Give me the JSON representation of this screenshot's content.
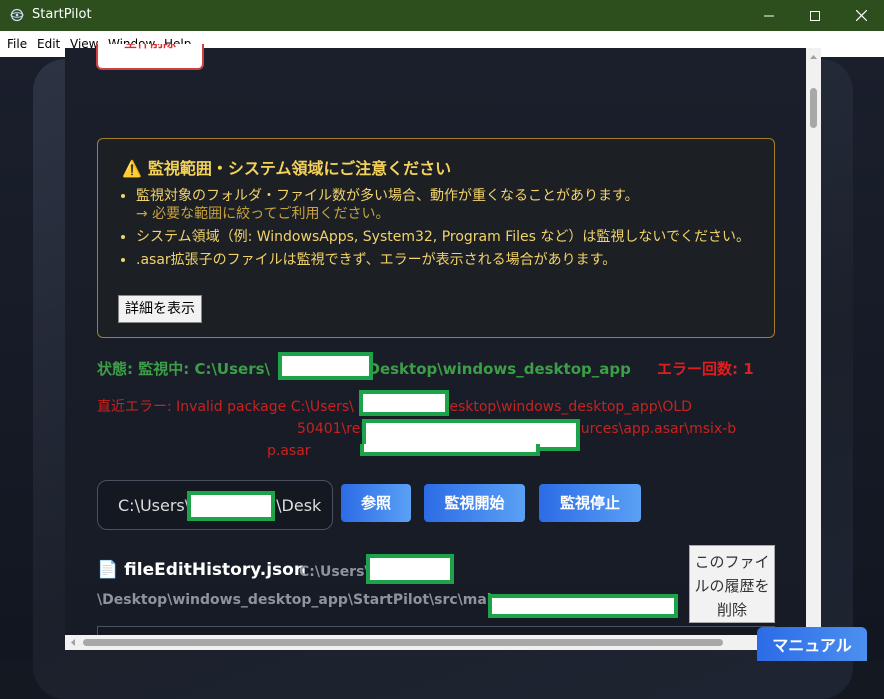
{
  "window": {
    "title": "StartPilot"
  },
  "menu": [
    "File",
    "Edit",
    "View",
    "Window",
    "Help"
  ],
  "toolbar": {
    "delete_all_label": "全件削除"
  },
  "warning": {
    "title": "監視範囲・システム領域にご注意ください",
    "items": [
      "監視対象のフォルダ・ファイル数が多い場合、動作が重くなることがあります。",
      "システム領域（例: WindowsApps, System32, Program Files など）は監視しないでください。",
      ".asar拡張子のファイルは監視できず、エラーが表示される場合があります。"
    ],
    "note": "→ 必要な範囲に絞ってご利用ください。",
    "detail_button": "詳細を表示"
  },
  "status": {
    "prefix": "状態: 監視中: C:\\Users\\",
    "suffix": "\\Desktop\\windows_desktop_app",
    "error_count": "エラー回数: 1"
  },
  "recent_error": {
    "part1": "直近エラー: Invalid package C:\\Users\\",
    "part2": "\\Desktop\\windows_desktop_app\\OLD",
    "part3": "50401\\release-builds\\win-unpacked\\resources\\app.asar\\msix-b",
    "part4": "p.asar"
  },
  "path_input": {
    "prefix": "C:\\Users\\",
    "suffix": "\\Desk"
  },
  "buttons": {
    "browse": "参照",
    "start": "監視開始",
    "stop": "監視停止"
  },
  "history": {
    "file_icon": "document-icon",
    "filename": "fileEditHistory.json",
    "path_prefix": "C:\\Users\\",
    "path_line2": "\\Desktop\\windows_desktop_app\\StartPilot\\src\\mai",
    "delete_label": "このファイルの履歴を削除"
  },
  "manual_button": "マニュアル"
}
